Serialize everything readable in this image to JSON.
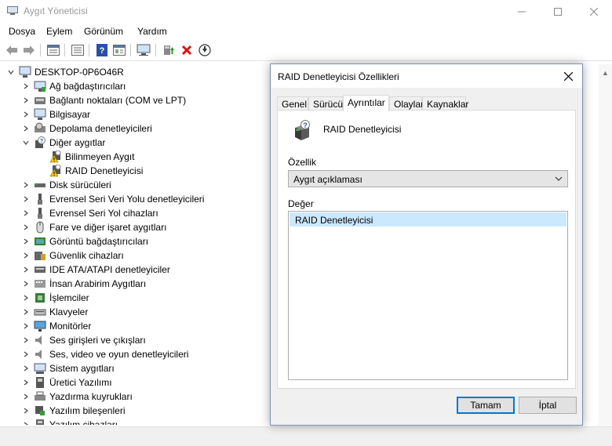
{
  "window": {
    "title": "Aygıt Yöneticisi"
  },
  "menu": [
    "Dosya",
    "Eylem",
    "Görünüm",
    "Yardım"
  ],
  "toolbar": {
    "icons": [
      "back-icon",
      "forward-icon",
      "properties-pane-icon",
      "list-icon",
      "help-icon",
      "view-icon",
      "monitor-scan-icon",
      "update-driver-icon",
      "uninstall-icon",
      "download-icon"
    ]
  },
  "tree": {
    "root": "DESKTOP-0P6O46R",
    "items": [
      {
        "label": "Ağ bağdaştırıcıları",
        "icon": "network-adapter-icon",
        "expanded": false,
        "level": 1
      },
      {
        "label": "Bağlantı noktaları (COM ve LPT)",
        "icon": "port-icon",
        "expanded": false,
        "level": 1
      },
      {
        "label": "Bilgisayar",
        "icon": "computer-icon",
        "expanded": false,
        "level": 1
      },
      {
        "label": "Depolama denetleyicileri",
        "icon": "storage-controller-icon",
        "expanded": false,
        "level": 1
      },
      {
        "label": "Diğer aygıtlar",
        "icon": "unknown-device-icon",
        "expanded": true,
        "level": 1
      },
      {
        "label": "Bilinmeyen Aygıt",
        "icon": "warning-device-icon",
        "level": 2
      },
      {
        "label": "RAID Denetleyicisi",
        "icon": "warning-device-icon",
        "level": 2
      },
      {
        "label": "Disk sürücüleri",
        "icon": "disk-drive-icon",
        "expanded": false,
        "level": 1
      },
      {
        "label": "Evrensel Seri Veri Yolu denetleyicileri",
        "icon": "usb-icon",
        "expanded": false,
        "level": 1
      },
      {
        "label": "Evrensel Seri Yol cihazları",
        "icon": "usb-icon",
        "expanded": false,
        "level": 1
      },
      {
        "label": "Fare ve diğer işaret aygıtları",
        "icon": "mouse-icon",
        "expanded": false,
        "level": 1
      },
      {
        "label": "Görüntü bağdaştırıcıları",
        "icon": "display-adapter-icon",
        "expanded": false,
        "level": 1
      },
      {
        "label": "Güvenlik cihazları",
        "icon": "security-device-icon",
        "expanded": false,
        "level": 1
      },
      {
        "label": "IDE ATA/ATAPI denetleyiciler",
        "icon": "ide-controller-icon",
        "expanded": false,
        "level": 1
      },
      {
        "label": "İnsan Arabirim Aygıtları",
        "icon": "hid-icon",
        "expanded": false,
        "level": 1
      },
      {
        "label": "İşlemciler",
        "icon": "processor-icon",
        "expanded": false,
        "level": 1
      },
      {
        "label": "Klavyeler",
        "icon": "keyboard-icon",
        "expanded": false,
        "level": 1
      },
      {
        "label": "Monitörler",
        "icon": "monitor-icon",
        "expanded": false,
        "level": 1
      },
      {
        "label": "Ses girişleri ve çıkışları",
        "icon": "speaker-icon",
        "expanded": false,
        "level": 1
      },
      {
        "label": "Ses, video ve oyun denetleyicileri",
        "icon": "speaker-icon",
        "expanded": false,
        "level": 1
      },
      {
        "label": "Sistem aygıtları",
        "icon": "system-device-icon",
        "expanded": false,
        "level": 1
      },
      {
        "label": "Üretici Yazılımı",
        "icon": "firmware-icon",
        "expanded": false,
        "level": 1
      },
      {
        "label": "Yazdırma kuyrukları",
        "icon": "printer-icon",
        "expanded": false,
        "level": 1
      },
      {
        "label": "Yazılım bileşenleri",
        "icon": "software-component-icon",
        "expanded": false,
        "level": 1
      },
      {
        "label": "Yazılım cihazları",
        "icon": "software-device-icon",
        "expanded": false,
        "level": 1
      }
    ]
  },
  "dialog": {
    "title": "RAID Denetleyicisi Özellikleri",
    "tabs": [
      "Genel",
      "Sürücü",
      "Ayrıntılar",
      "Olaylar",
      "Kaynaklar"
    ],
    "active_tab": "Ayrıntılar",
    "device_name": "RAID Denetleyicisi",
    "property_label": "Özellik",
    "property_value": "Aygıt açıklaması",
    "value_label": "Değer",
    "values": [
      "RAID Denetleyicisi"
    ],
    "ok_label": "Tamam",
    "cancel_label": "İptal"
  },
  "colors": {
    "selection": "#cce8ff",
    "accent": "#0078d7",
    "dialog_bg": "#f0f0f0"
  }
}
